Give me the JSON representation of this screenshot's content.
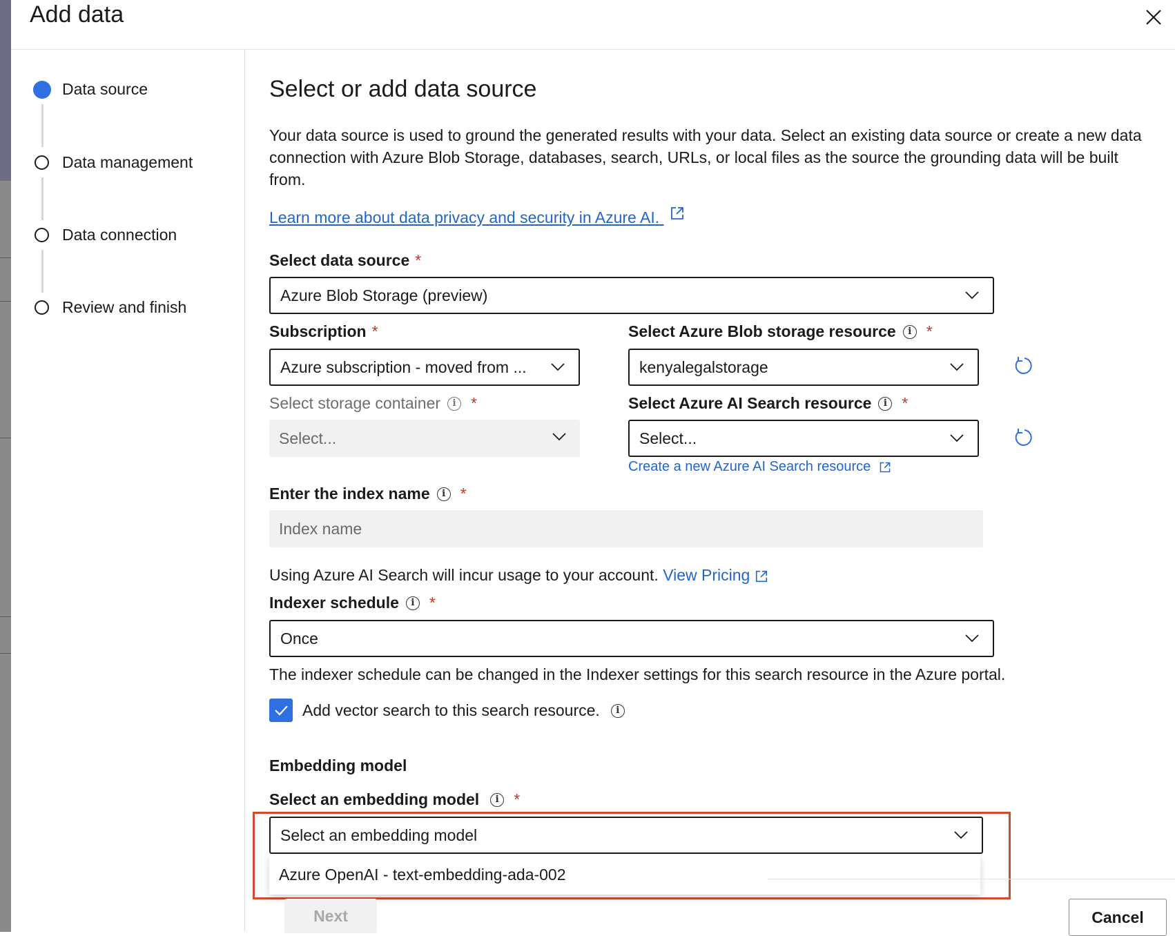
{
  "dialog": {
    "title": "Add data"
  },
  "steps": [
    {
      "label": "Data source",
      "active": true
    },
    {
      "label": "Data management",
      "active": false
    },
    {
      "label": "Data connection",
      "active": false
    },
    {
      "label": "Review and finish",
      "active": false
    }
  ],
  "main": {
    "heading": "Select or add data source",
    "description": "Your data source is used to ground the generated results with your data. Select an existing data source or create a new data connection with Azure Blob Storage, databases, search, URLs, or local files as the source the grounding data will be built from.",
    "learn_more": "Learn more about data privacy and security in Azure AI.",
    "data_source": {
      "label": "Select data source",
      "value": "Azure Blob Storage (preview)"
    },
    "subscription": {
      "label": "Subscription",
      "value": "Azure subscription - moved from ..."
    },
    "blob_resource": {
      "label": "Select Azure Blob storage resource",
      "value": "kenyalegalstorage"
    },
    "storage_container": {
      "label": "Select storage container",
      "placeholder": "Select..."
    },
    "search_resource": {
      "label": "Select Azure AI Search resource",
      "placeholder": "Select..."
    },
    "create_search_link": "Create a new Azure AI Search resource",
    "index_name": {
      "label": "Enter the index name",
      "placeholder": "Index name"
    },
    "usage_note": "Using Azure AI Search will incur usage to your account.",
    "view_pricing": "View Pricing",
    "indexer_schedule": {
      "label": "Indexer schedule",
      "value": "Once"
    },
    "indexer_note": "The indexer schedule can be changed in the Indexer settings for this search resource in the Azure portal.",
    "vector_search": {
      "label": "Add vector search to this search resource.",
      "checked": true
    },
    "embedding_section": "Embedding model",
    "embedding_model": {
      "label": "Select an embedding model",
      "value": "Select an embedding model"
    },
    "dropdown_options": [
      "Azure OpenAI - text-embedding-ada-002"
    ]
  },
  "footer": {
    "next_label": "Next",
    "cancel_label": "Cancel"
  },
  "colors": {
    "accent": "#2f6fe0",
    "link": "#2166c9",
    "required": "#c0392b",
    "highlight": "#d24a2e"
  }
}
